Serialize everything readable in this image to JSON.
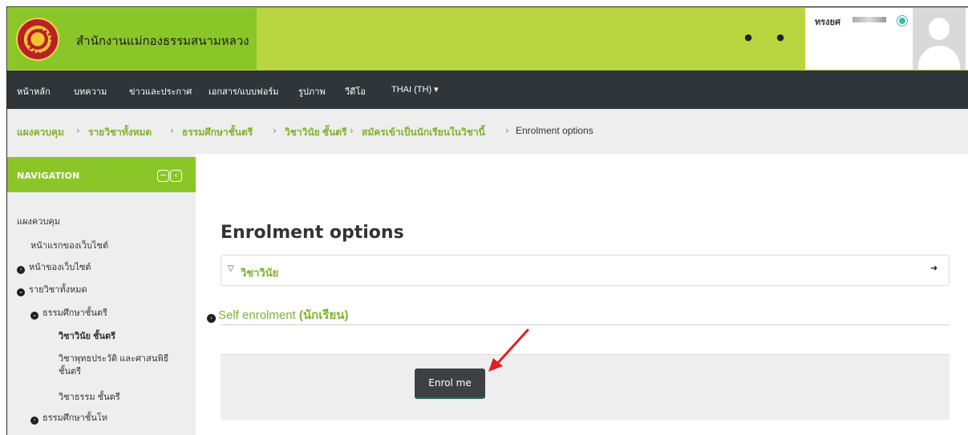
{
  "site": {
    "name": "สำนักงานแม่กองธรรมสนามหลวง"
  },
  "user": {
    "name": "ทรงยศ"
  },
  "topnav": [
    "หน้าหลัก",
    "บทความ",
    "ข่าวและประกาศ",
    "เอกสาร/แบบฟอร์ม",
    "รูปภาพ",
    "วีดีโอ",
    "THAI (TH)"
  ],
  "breadcrumb": [
    "แผงควบคุม",
    "รายวิชาทั้งหมด",
    "ธรรมศึกษาชั้นตรี",
    "วิชาวินัย ชั้นตรี",
    "สมัครเข้าเป็นนักเรียนในวิชานี้",
    "Enrolment options"
  ],
  "sidebar": {
    "title": "NAVIGATION",
    "items": [
      "แผงควบคุม",
      "หน้าแรกของเว็บไซต์",
      "หน้าของเว็บไซต์",
      "รายวิชาทั้งหมด",
      "ธรรมศึกษาชั้นตรี",
      "วิชาวินัย ชั้นตรี",
      "วิชาพุทธประวัติ และศาสนพิธี",
      "ชั้นตรี",
      "วิชาธรรม ชั้นตรี",
      "ธรรมศึกษาชั้นโท"
    ]
  },
  "main": {
    "title": "Enrolment options",
    "course": "วิชาวินัย",
    "enrol_method": "Self enrolment",
    "enrol_role": "(นักเรียน)",
    "button": "Enrol me"
  },
  "colors": {
    "accent": "#80b22d",
    "header": "#b9d53f",
    "nav": "#2f3538",
    "arrow": "#e02020"
  }
}
